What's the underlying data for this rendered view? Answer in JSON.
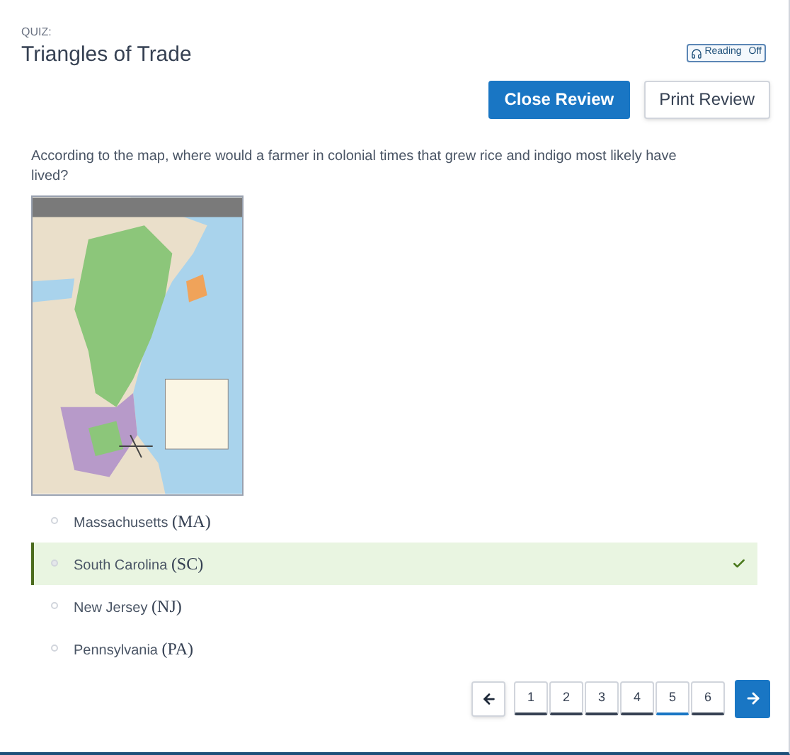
{
  "header": {
    "eyebrow": "QUIZ:",
    "title": "Triangles of Trade",
    "reading_toggle": {
      "label": "Reading",
      "state": "Off"
    }
  },
  "actions": [
    {
      "label": "Close Review",
      "kind": "primary"
    },
    {
      "label": "Print Review",
      "kind": "secondary"
    }
  ],
  "question": {
    "text": "According to the map, where would a farmer in colonial times that grew rice and indigo most likely have lived?"
  },
  "options": [
    {
      "name": "Massachusetts",
      "abbr": "(MA)",
      "selected": false,
      "correct": false
    },
    {
      "name": "South Carolina",
      "abbr": "(SC)",
      "selected": true,
      "correct": true
    },
    {
      "name": "New Jersey",
      "abbr": "(NJ)",
      "selected": false,
      "correct": false
    },
    {
      "name": "Pennsylvania",
      "abbr": "(PA)",
      "selected": false,
      "correct": false
    }
  ],
  "pagination": {
    "pages": [
      {
        "label": "1",
        "selected": false
      },
      {
        "label": "2",
        "selected": false
      },
      {
        "label": "3",
        "selected": false
      },
      {
        "label": "4",
        "selected": false
      },
      {
        "label": "5",
        "selected": true
      },
      {
        "label": "6",
        "selected": false
      }
    ]
  }
}
